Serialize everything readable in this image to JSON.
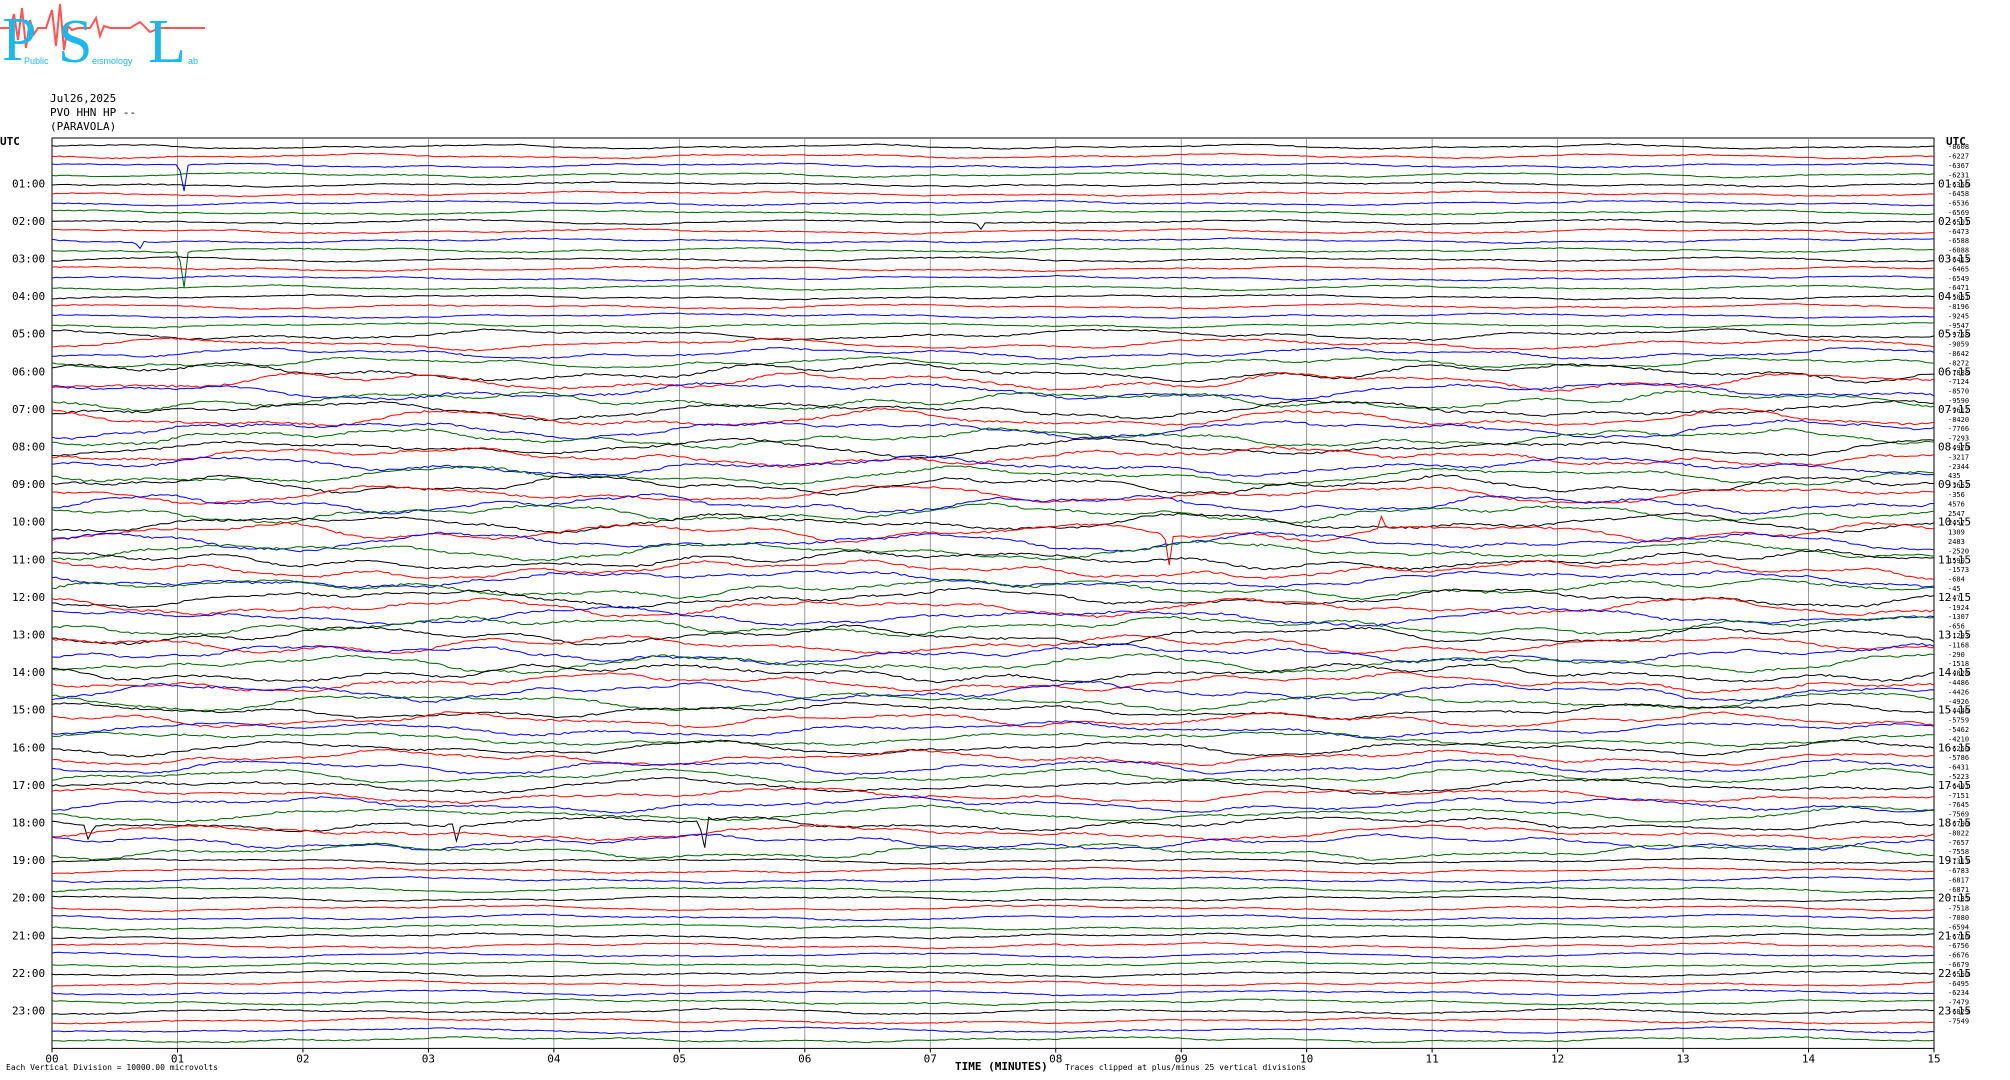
{
  "logo": {
    "letters": [
      "P",
      "S",
      "L"
    ],
    "small": [
      "Public",
      "eismology",
      "ab"
    ]
  },
  "header": {
    "date": "Jul26,2025",
    "station": "PVO HHN HP --",
    "location": "(PARAVOLA)"
  },
  "footer": {
    "scale_note": "Each Vertical Division = 10000.00 microvolts",
    "axis_title": "TIME (MINUTES)",
    "clip_note": "Traces clipped at plus/minus 25 vertical divisions"
  },
  "colors": {
    "cycle": [
      "#000000",
      "#ff0000",
      "#0000ff",
      "#006400"
    ],
    "grid": "#808080",
    "logo": "#1fb6e8",
    "logo_trace": "#ff5555"
  },
  "chart_data": {
    "type": "line",
    "title": "",
    "xlabel": "TIME (MINUTES)",
    "x_ticks": [
      "00",
      "01",
      "02",
      "03",
      "04",
      "05",
      "06",
      "07",
      "08",
      "09",
      "10",
      "11",
      "12",
      "13",
      "14",
      "15"
    ],
    "xlim": [
      0,
      15
    ],
    "left_axis_title": "UTC",
    "right_axis_title": "UTC",
    "left_hour_labels": [
      "01:00",
      "02:00",
      "03:00",
      "04:00",
      "05:00",
      "06:00",
      "07:00",
      "08:00",
      "09:00",
      "10:00",
      "11:00",
      "12:00",
      "13:00",
      "14:00",
      "15:00",
      "16:00",
      "17:00",
      "18:00",
      "19:00",
      "20:00",
      "21:00",
      "22:00",
      "23:00"
    ],
    "right_hour_labels": [
      "01:15",
      "02:15",
      "03:15",
      "04:15",
      "05:15",
      "06:15",
      "07:15",
      "08:15",
      "09:15",
      "10:15",
      "11:15",
      "12:15",
      "13:15",
      "14:15",
      "15:15",
      "16:15",
      "17:15",
      "18:15",
      "19:15",
      "20:15",
      "21:15",
      "22:15",
      "23:15"
    ],
    "trace_count": 96,
    "trace_minutes": 15,
    "trace_color_order": [
      "black",
      "red",
      "blue",
      "green"
    ],
    "dc_offsets": [
      "-8608",
      "-6227",
      "-6367",
      "-6231",
      "-6356",
      "-6458",
      "-6536",
      "-6569",
      "-6501",
      "-6473",
      "-6588",
      "-6088",
      "-6413",
      "-6465",
      "-6549",
      "-6471",
      "-5861",
      "-8196",
      "-9245",
      "-9547",
      "-9758",
      "-9059",
      "-8642",
      "-8272",
      "-7888",
      "-7124",
      "-8570",
      "-9590",
      "-9612",
      "-8420",
      "-7766",
      "-7293",
      "-4970",
      "-3217",
      "-2344",
      "435",
      "-3662",
      "-356",
      "4576",
      "2547",
      "2457",
      "1309",
      "2483",
      "-2520",
      "1590",
      "-1573",
      "-684",
      "-45",
      "-47",
      "-1924",
      "-1307",
      "-656",
      "-1293",
      "-1168",
      "-290",
      "-1518",
      "-4828",
      "-4486",
      "-4426",
      "-4926",
      "-4446",
      "-5759",
      "-5462",
      "-4210",
      "-6250",
      "-5786",
      "-6431",
      "-5223",
      "-6491",
      "-7151",
      "-7645",
      "-7569",
      "-6790",
      "-8022",
      "-7657",
      "-7558",
      "-7313",
      "-6783",
      "-6817",
      "-6871",
      "-7135",
      "-7518",
      "-7080",
      "-6594",
      "-6716",
      "-6756",
      "-6676",
      "-6679",
      "-6560",
      "-6495",
      "-6234",
      "-7479",
      "-6829",
      "-7549"
    ],
    "notable_events": [
      {
        "trace_hour": "00:30",
        "minute": 1.05,
        "note": "spike"
      },
      {
        "trace_hour": "02:00",
        "minute": 7.4,
        "note": "burst"
      },
      {
        "trace_hour": "10:15",
        "minute": 8.9,
        "note": "spike"
      },
      {
        "trace_hour": "18:00",
        "minute": 3.2,
        "note": "large spikes"
      },
      {
        "trace_hour": "18:00",
        "minute": 5.2,
        "note": "large spike"
      }
    ]
  }
}
